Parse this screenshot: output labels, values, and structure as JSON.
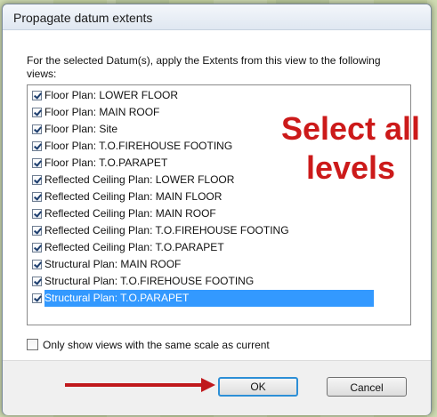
{
  "dialog": {
    "title": "Propagate datum extents",
    "instruction": "For the selected Datum(s), apply the Extents from this view to the following views:",
    "views": [
      {
        "label": "Floor Plan: LOWER FLOOR",
        "checked": true
      },
      {
        "label": "Floor Plan: MAIN ROOF",
        "checked": true
      },
      {
        "label": "Floor Plan: Site",
        "checked": true
      },
      {
        "label": "Floor Plan: T.O.FIREHOUSE FOOTING",
        "checked": true
      },
      {
        "label": "Floor Plan: T.O.PARAPET",
        "checked": true
      },
      {
        "label": "Reflected Ceiling Plan: LOWER FLOOR",
        "checked": true
      },
      {
        "label": "Reflected Ceiling Plan: MAIN FLOOR",
        "checked": true
      },
      {
        "label": "Reflected Ceiling Plan: MAIN ROOF",
        "checked": true
      },
      {
        "label": "Reflected Ceiling Plan: T.O.FIREHOUSE FOOTING",
        "checked": true
      },
      {
        "label": "Reflected Ceiling Plan: T.O.PARAPET",
        "checked": true
      },
      {
        "label": "Structural Plan: MAIN ROOF",
        "checked": true
      },
      {
        "label": "Structural Plan: T.O.FIREHOUSE FOOTING",
        "checked": true
      },
      {
        "label": "Structural Plan: T.O.PARAPET",
        "checked": true,
        "selected": true
      }
    ],
    "scale_option": {
      "label": "Only show views with the same scale as current",
      "checked": false
    },
    "ok_label": "OK",
    "cancel_label": "Cancel"
  },
  "annotation": {
    "line1": "Select all",
    "line2": "levels"
  },
  "colors": {
    "annotation": "#cc1a1a",
    "selection": "#3399ff",
    "arrow": "#c0191c"
  }
}
